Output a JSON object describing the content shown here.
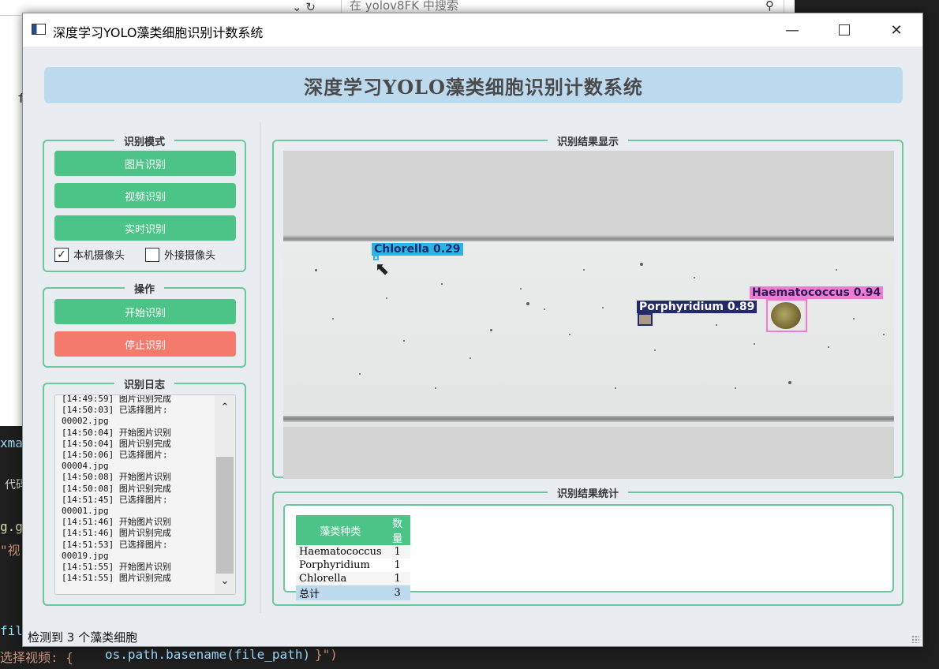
{
  "background": {
    "explorer_search_placeholder": "在 yolov8FK 中搜索",
    "nav_glyphs": "⌄ ↻",
    "search_icon": "search-icon",
    "code_lines": [
      {
        "text": "f",
        "color": "#222222"
      },
      {
        "text": "xma",
        "color": "#9cdcfe"
      },
      {
        "text": "代码",
        "color": "#d4d4d4"
      },
      {
        "text": "g.g",
        "color": "#dcdcaa"
      },
      {
        "text": "\"视",
        "color": "#ce9178"
      },
      {
        "text": "fil",
        "color": "#9cdcfe"
      }
    ],
    "bottom_code_prefix": "选择视频: {",
    "bottom_code_expr": "os.path.basename(file_path)",
    "bottom_code_suffix": "}\")"
  },
  "window": {
    "title": "深度学习YOLO藻类细胞识别计数系统",
    "minimize_glyph": "—",
    "close_glyph": "✕"
  },
  "header": {
    "title": "深度学习YOLO藻类细胞识别计数系统"
  },
  "mode_group": {
    "title": "识别模式",
    "buttons": [
      "图片识别",
      "视频识别",
      "实时识别"
    ],
    "checkboxes": [
      {
        "label": "本机摄像头",
        "checked": true
      },
      {
        "label": "外接摄像头",
        "checked": false
      }
    ]
  },
  "ops_group": {
    "title": "操作",
    "start": "开始识别",
    "stop": "停止识别"
  },
  "log_group": {
    "title": "识别日志",
    "lines": [
      "[14:49:59] 图片识别完成",
      "[14:50:03] 已选择图片:",
      "00002.jpg",
      "[14:50:04] 开始图片识别",
      "[14:50:04] 图片识别完成",
      "[14:50:06] 已选择图片:",
      "00004.jpg",
      "[14:50:08] 开始图片识别",
      "[14:50:08] 图片识别完成",
      "[14:51:45] 已选择图片:",
      "00001.jpg",
      "[14:51:46] 开始图片识别",
      "[14:51:46] 图片识别完成",
      "[14:51:53] 已选择图片:",
      "00019.jpg",
      "[14:51:55] 开始图片识别",
      "[14:51:55] 图片识别完成"
    ]
  },
  "result_group": {
    "title": "识别结果显示",
    "detections": [
      {
        "label": "Chlorella",
        "score": "0.29",
        "text": "Chlorella 0.29",
        "color": "#2bb4e6",
        "text_color": "#1a2a6e"
      },
      {
        "label": "Porphyridium",
        "score": "0.89",
        "text": "Porphyridium 0.89",
        "color": "#232a6b",
        "text_color": "#ffffff"
      },
      {
        "label": "Haematococcus",
        "score": "0.94",
        "text": "Haematococcus 0.94",
        "color": "#f07bd3",
        "text_color": "#2a1a55"
      }
    ]
  },
  "stats_group": {
    "title": "识别结果统计",
    "headers": [
      "藻类种类",
      "数量"
    ],
    "rows": [
      {
        "name": "Haematococcus",
        "count": "1"
      },
      {
        "name": "Porphyridium",
        "count": "1"
      },
      {
        "name": "Chlorella",
        "count": "1"
      }
    ],
    "total_label": "总计",
    "total_count": "3",
    "colors": {
      "header": "#4cc487",
      "total_row": "#bcd9ee",
      "odd_row": "#f5f5f5"
    }
  },
  "status": {
    "text": "检测到 3 个藻类细胞"
  }
}
